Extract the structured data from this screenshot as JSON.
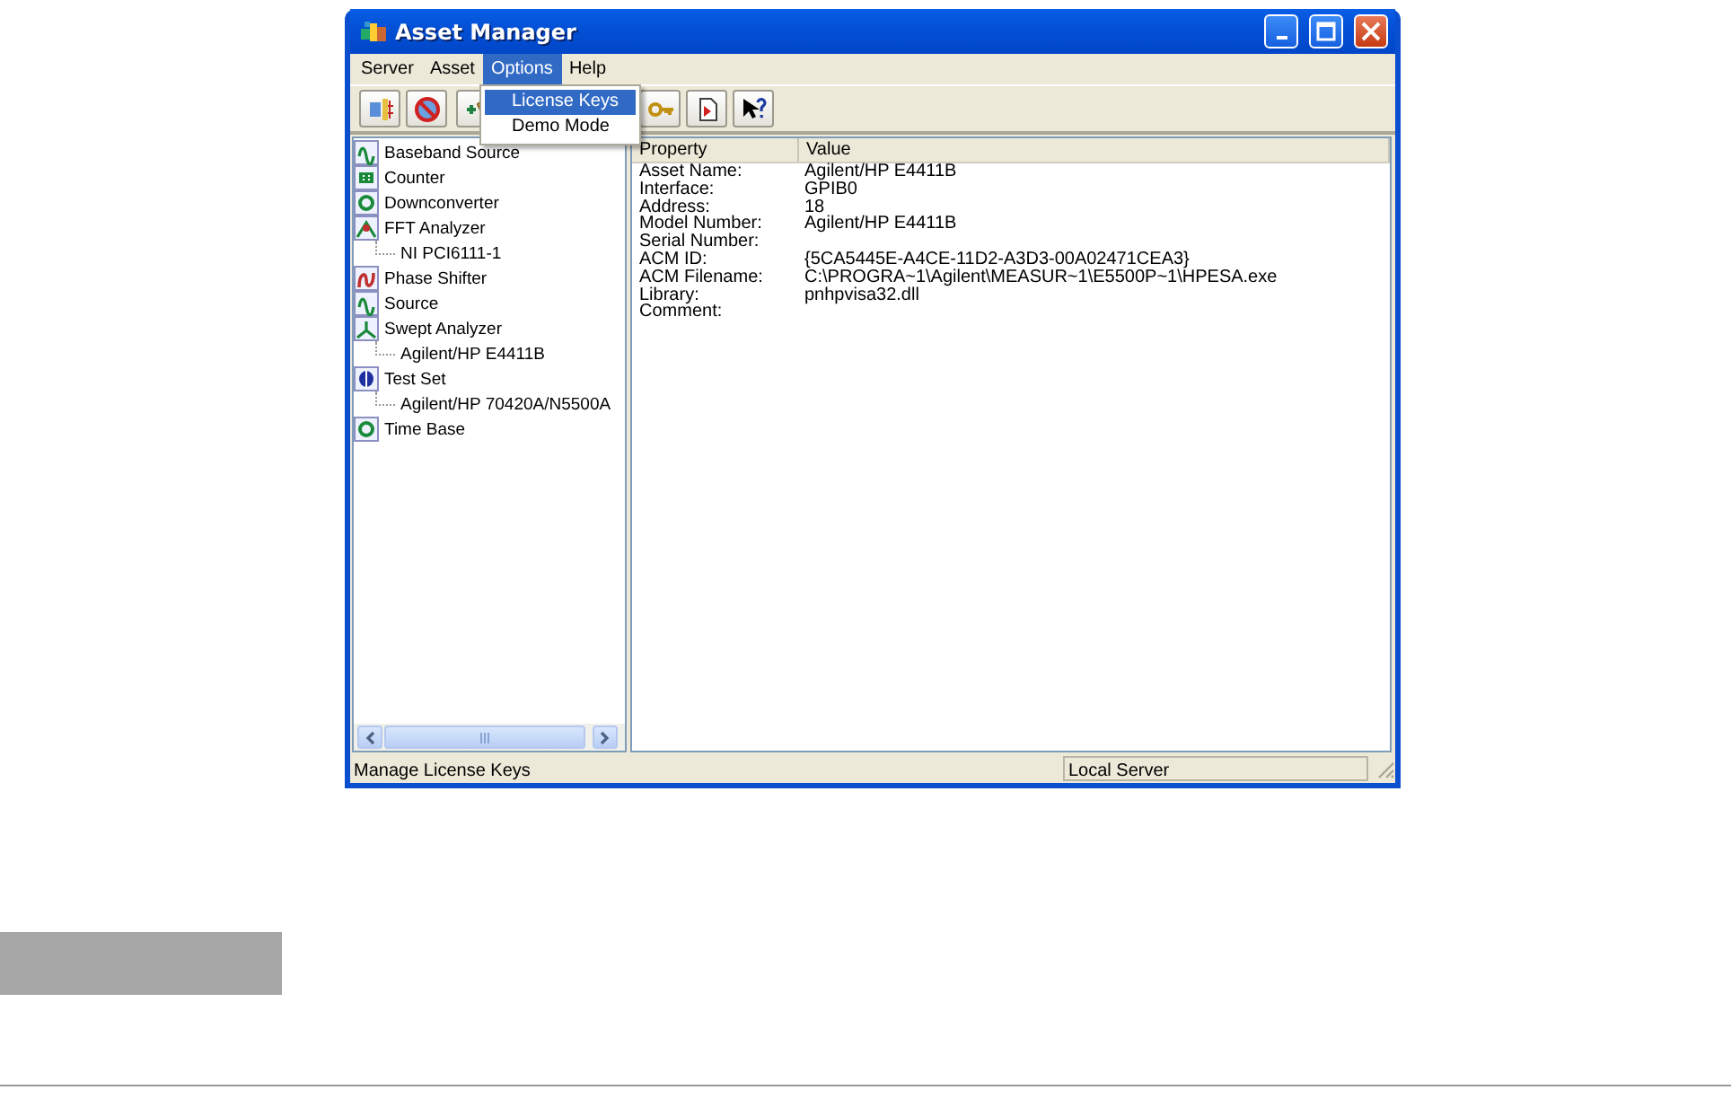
{
  "window": {
    "title": "Asset Manager"
  },
  "menu_bar": [
    {
      "label": "Server",
      "selected": false
    },
    {
      "label": "Asset",
      "selected": false
    },
    {
      "label": "Options",
      "selected": true
    },
    {
      "label": "Help",
      "selected": false
    }
  ],
  "dropdown": {
    "items": [
      {
        "label": "License Keys",
        "selected": true
      },
      {
        "label": "Demo Mode",
        "selected": false
      }
    ]
  },
  "tree": [
    {
      "label": "Baseband Source"
    },
    {
      "label": "Counter"
    },
    {
      "label": "Downconverter"
    },
    {
      "label": "FFT Analyzer",
      "children": [
        {
          "label": "NI PCI6111-1"
        }
      ]
    },
    {
      "label": "Phase Shifter"
    },
    {
      "label": "Source"
    },
    {
      "label": "Swept Analyzer",
      "children": [
        {
          "label": "Agilent/HP E4411B"
        }
      ]
    },
    {
      "label": "Test Set",
      "children": [
        {
          "label": "Agilent/HP 70420A/N5500A"
        }
      ]
    },
    {
      "label": "Time Base"
    }
  ],
  "properties": {
    "columns": [
      "Property",
      "Value"
    ],
    "rows": [
      {
        "property": "Asset Name:",
        "value": "Agilent/HP E4411B"
      },
      {
        "property": "Interface:",
        "value": "GPIB0"
      },
      {
        "property": "Address:",
        "value": "18"
      },
      {
        "property": "Model Number:",
        "value": "Agilent/HP E4411B"
      },
      {
        "property": "Serial Number:"
      },
      {
        "property": "ACM ID:",
        "value": "{5CA5445E-A4CE-11D2-A3D3-00A02471CEA3}"
      },
      {
        "property": "ACM Filename:",
        "value": "C:\\PROGRA~1\\Agilent\\MEASUR~1\\E5500P~1\\HPESA.exe"
      },
      {
        "property": "Library:",
        "value": "pnhpvisa32.dll"
      },
      {
        "property": "Comment:"
      }
    ]
  },
  "status_bar": {
    "message": "Manage License Keys",
    "server": "Local Server"
  }
}
